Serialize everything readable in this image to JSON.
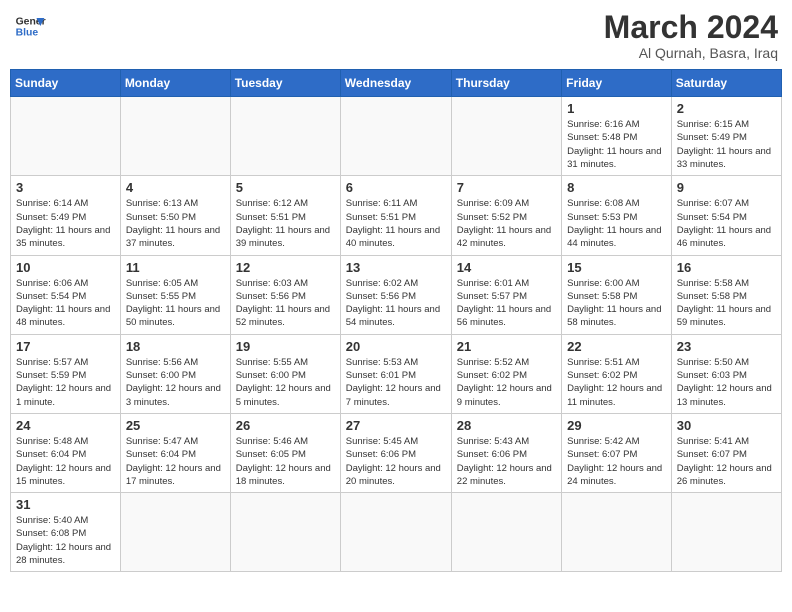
{
  "header": {
    "logo_line1": "General",
    "logo_line2": "Blue",
    "month_year": "March 2024",
    "location": "Al Qurnah, Basra, Iraq"
  },
  "weekdays": [
    "Sunday",
    "Monday",
    "Tuesday",
    "Wednesday",
    "Thursday",
    "Friday",
    "Saturday"
  ],
  "weeks": [
    [
      {
        "day": "",
        "info": ""
      },
      {
        "day": "",
        "info": ""
      },
      {
        "day": "",
        "info": ""
      },
      {
        "day": "",
        "info": ""
      },
      {
        "day": "",
        "info": ""
      },
      {
        "day": "1",
        "info": "Sunrise: 6:16 AM\nSunset: 5:48 PM\nDaylight: 11 hours and 31 minutes."
      },
      {
        "day": "2",
        "info": "Sunrise: 6:15 AM\nSunset: 5:49 PM\nDaylight: 11 hours and 33 minutes."
      }
    ],
    [
      {
        "day": "3",
        "info": "Sunrise: 6:14 AM\nSunset: 5:49 PM\nDaylight: 11 hours and 35 minutes."
      },
      {
        "day": "4",
        "info": "Sunrise: 6:13 AM\nSunset: 5:50 PM\nDaylight: 11 hours and 37 minutes."
      },
      {
        "day": "5",
        "info": "Sunrise: 6:12 AM\nSunset: 5:51 PM\nDaylight: 11 hours and 39 minutes."
      },
      {
        "day": "6",
        "info": "Sunrise: 6:11 AM\nSunset: 5:51 PM\nDaylight: 11 hours and 40 minutes."
      },
      {
        "day": "7",
        "info": "Sunrise: 6:09 AM\nSunset: 5:52 PM\nDaylight: 11 hours and 42 minutes."
      },
      {
        "day": "8",
        "info": "Sunrise: 6:08 AM\nSunset: 5:53 PM\nDaylight: 11 hours and 44 minutes."
      },
      {
        "day": "9",
        "info": "Sunrise: 6:07 AM\nSunset: 5:54 PM\nDaylight: 11 hours and 46 minutes."
      }
    ],
    [
      {
        "day": "10",
        "info": "Sunrise: 6:06 AM\nSunset: 5:54 PM\nDaylight: 11 hours and 48 minutes."
      },
      {
        "day": "11",
        "info": "Sunrise: 6:05 AM\nSunset: 5:55 PM\nDaylight: 11 hours and 50 minutes."
      },
      {
        "day": "12",
        "info": "Sunrise: 6:03 AM\nSunset: 5:56 PM\nDaylight: 11 hours and 52 minutes."
      },
      {
        "day": "13",
        "info": "Sunrise: 6:02 AM\nSunset: 5:56 PM\nDaylight: 11 hours and 54 minutes."
      },
      {
        "day": "14",
        "info": "Sunrise: 6:01 AM\nSunset: 5:57 PM\nDaylight: 11 hours and 56 minutes."
      },
      {
        "day": "15",
        "info": "Sunrise: 6:00 AM\nSunset: 5:58 PM\nDaylight: 11 hours and 58 minutes."
      },
      {
        "day": "16",
        "info": "Sunrise: 5:58 AM\nSunset: 5:58 PM\nDaylight: 11 hours and 59 minutes."
      }
    ],
    [
      {
        "day": "17",
        "info": "Sunrise: 5:57 AM\nSunset: 5:59 PM\nDaylight: 12 hours and 1 minute."
      },
      {
        "day": "18",
        "info": "Sunrise: 5:56 AM\nSunset: 6:00 PM\nDaylight: 12 hours and 3 minutes."
      },
      {
        "day": "19",
        "info": "Sunrise: 5:55 AM\nSunset: 6:00 PM\nDaylight: 12 hours and 5 minutes."
      },
      {
        "day": "20",
        "info": "Sunrise: 5:53 AM\nSunset: 6:01 PM\nDaylight: 12 hours and 7 minutes."
      },
      {
        "day": "21",
        "info": "Sunrise: 5:52 AM\nSunset: 6:02 PM\nDaylight: 12 hours and 9 minutes."
      },
      {
        "day": "22",
        "info": "Sunrise: 5:51 AM\nSunset: 6:02 PM\nDaylight: 12 hours and 11 minutes."
      },
      {
        "day": "23",
        "info": "Sunrise: 5:50 AM\nSunset: 6:03 PM\nDaylight: 12 hours and 13 minutes."
      }
    ],
    [
      {
        "day": "24",
        "info": "Sunrise: 5:48 AM\nSunset: 6:04 PM\nDaylight: 12 hours and 15 minutes."
      },
      {
        "day": "25",
        "info": "Sunrise: 5:47 AM\nSunset: 6:04 PM\nDaylight: 12 hours and 17 minutes."
      },
      {
        "day": "26",
        "info": "Sunrise: 5:46 AM\nSunset: 6:05 PM\nDaylight: 12 hours and 18 minutes."
      },
      {
        "day": "27",
        "info": "Sunrise: 5:45 AM\nSunset: 6:06 PM\nDaylight: 12 hours and 20 minutes."
      },
      {
        "day": "28",
        "info": "Sunrise: 5:43 AM\nSunset: 6:06 PM\nDaylight: 12 hours and 22 minutes."
      },
      {
        "day": "29",
        "info": "Sunrise: 5:42 AM\nSunset: 6:07 PM\nDaylight: 12 hours and 24 minutes."
      },
      {
        "day": "30",
        "info": "Sunrise: 5:41 AM\nSunset: 6:07 PM\nDaylight: 12 hours and 26 minutes."
      }
    ],
    [
      {
        "day": "31",
        "info": "Sunrise: 5:40 AM\nSunset: 6:08 PM\nDaylight: 12 hours and 28 minutes."
      },
      {
        "day": "",
        "info": ""
      },
      {
        "day": "",
        "info": ""
      },
      {
        "day": "",
        "info": ""
      },
      {
        "day": "",
        "info": ""
      },
      {
        "day": "",
        "info": ""
      },
      {
        "day": "",
        "info": ""
      }
    ]
  ]
}
